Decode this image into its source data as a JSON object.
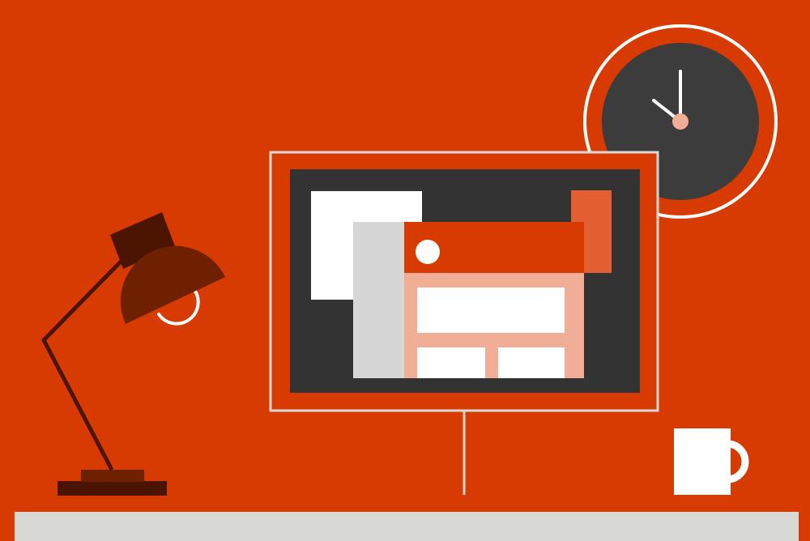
{
  "scene": {
    "background_color": "#D83B01",
    "desk_color": "#D8D8D4",
    "dark_screen_color": "#333333",
    "light_gray": "#D6D6D6",
    "white": "#FFFFFF",
    "pale_orange": "#F1AE96",
    "light_orange": "#E35F32",
    "lamp_dark": "#4A1400",
    "lamp_shade": "#6E2000",
    "clock_face_color": "#3C3C3C",
    "clock_center_color": "#F1AE96"
  },
  "icons": {
    "lamp": "desk-lamp-icon",
    "monitor": "monitor-icon",
    "clock": "wall-clock-icon",
    "mug": "coffee-mug-icon"
  }
}
